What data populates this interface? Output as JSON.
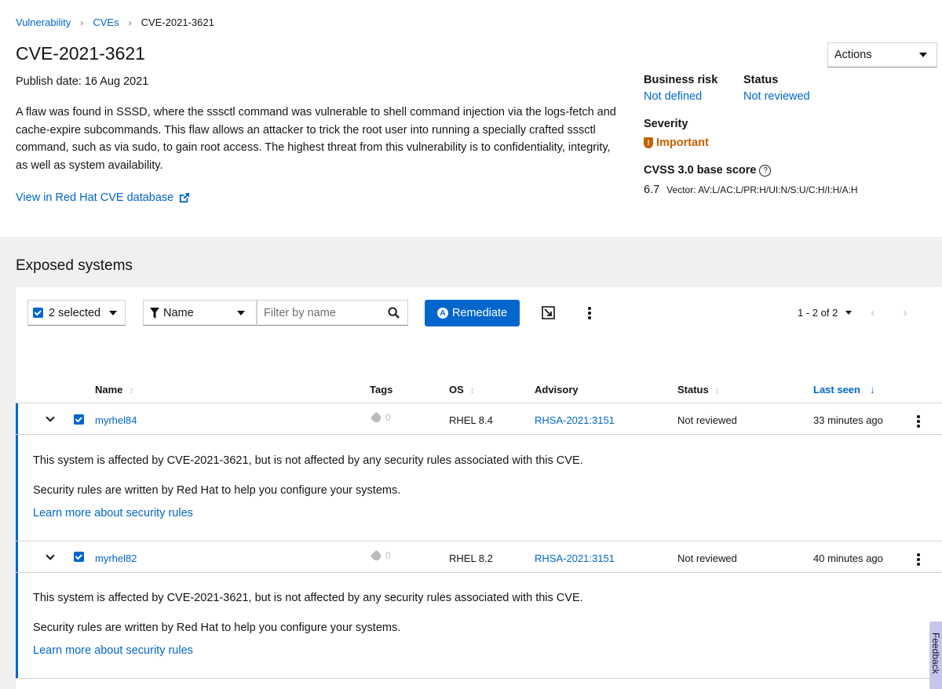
{
  "breadcrumb": {
    "items": [
      "Vulnerability",
      "CVEs"
    ],
    "current": "CVE-2021-3621"
  },
  "header": {
    "title": "CVE-2021-3621",
    "publish_date": "Publish date: 16 Aug 2021",
    "description": "A flaw was found in SSSD, where the sssctl command was vulnerable to shell command injection via the logs-fetch and cache-expire subcommands. This flaw allows an attacker to trick the root user into running a specially crafted sssctl command, such as via sudo, to gain root access. The highest threat from this vulnerability is to confidentiality, integrity, as well as system availability.",
    "external_link": "View in Red Hat CVE database",
    "actions_label": "Actions"
  },
  "meta": {
    "business_risk_label": "Business risk",
    "business_risk_value": "Not defined",
    "status_label": "Status",
    "status_value": "Not reviewed",
    "severity_label": "Severity",
    "severity_value": "Important",
    "severity_color": "#c46100",
    "cvss_label": "CVSS 3.0 base score",
    "cvss_score": "6.7",
    "cvss_vector": "Vector: AV:L/AC:L/PR:H/UI:N/S:U/C:H/I:H/A:H"
  },
  "exposed": {
    "title": "Exposed systems",
    "bulk_select": "2 selected",
    "filter_type": "Name",
    "filter_placeholder": "Filter by name",
    "remediate_label": "Remediate",
    "pagination": "1 - 2 of 2"
  },
  "table": {
    "columns": [
      "Name",
      "Tags",
      "OS",
      "Advisory",
      "Status",
      "Last seen"
    ],
    "rows": [
      {
        "name": "myrhel84",
        "tags": "0",
        "os": "RHEL 8.4",
        "advisory": "RHSA-2021:3151",
        "status": "Not reviewed",
        "last_seen": "33 minutes ago",
        "expanded_line1": "This system is affected by CVE-2021-3621, but is not affected by any security rules associated with this CVE.",
        "expanded_line2": "Security rules are written by Red Hat to help you configure your systems.",
        "expanded_link": "Learn more about security rules"
      },
      {
        "name": "myrhel82",
        "tags": "0",
        "os": "RHEL 8.2",
        "advisory": "RHSA-2021:3151",
        "status": "Not reviewed",
        "last_seen": "40 minutes ago",
        "expanded_line1": "This system is affected by CVE-2021-3621, but is not affected by any security rules associated with this CVE.",
        "expanded_line2": "Security rules are written by Red Hat to help you configure your systems.",
        "expanded_link": "Learn more about security rules"
      }
    ]
  },
  "feedback_label": "Feedback",
  "colors": {
    "link": "#0066cc",
    "primary_button": "#0066cc",
    "band": "#f0f0f0"
  }
}
